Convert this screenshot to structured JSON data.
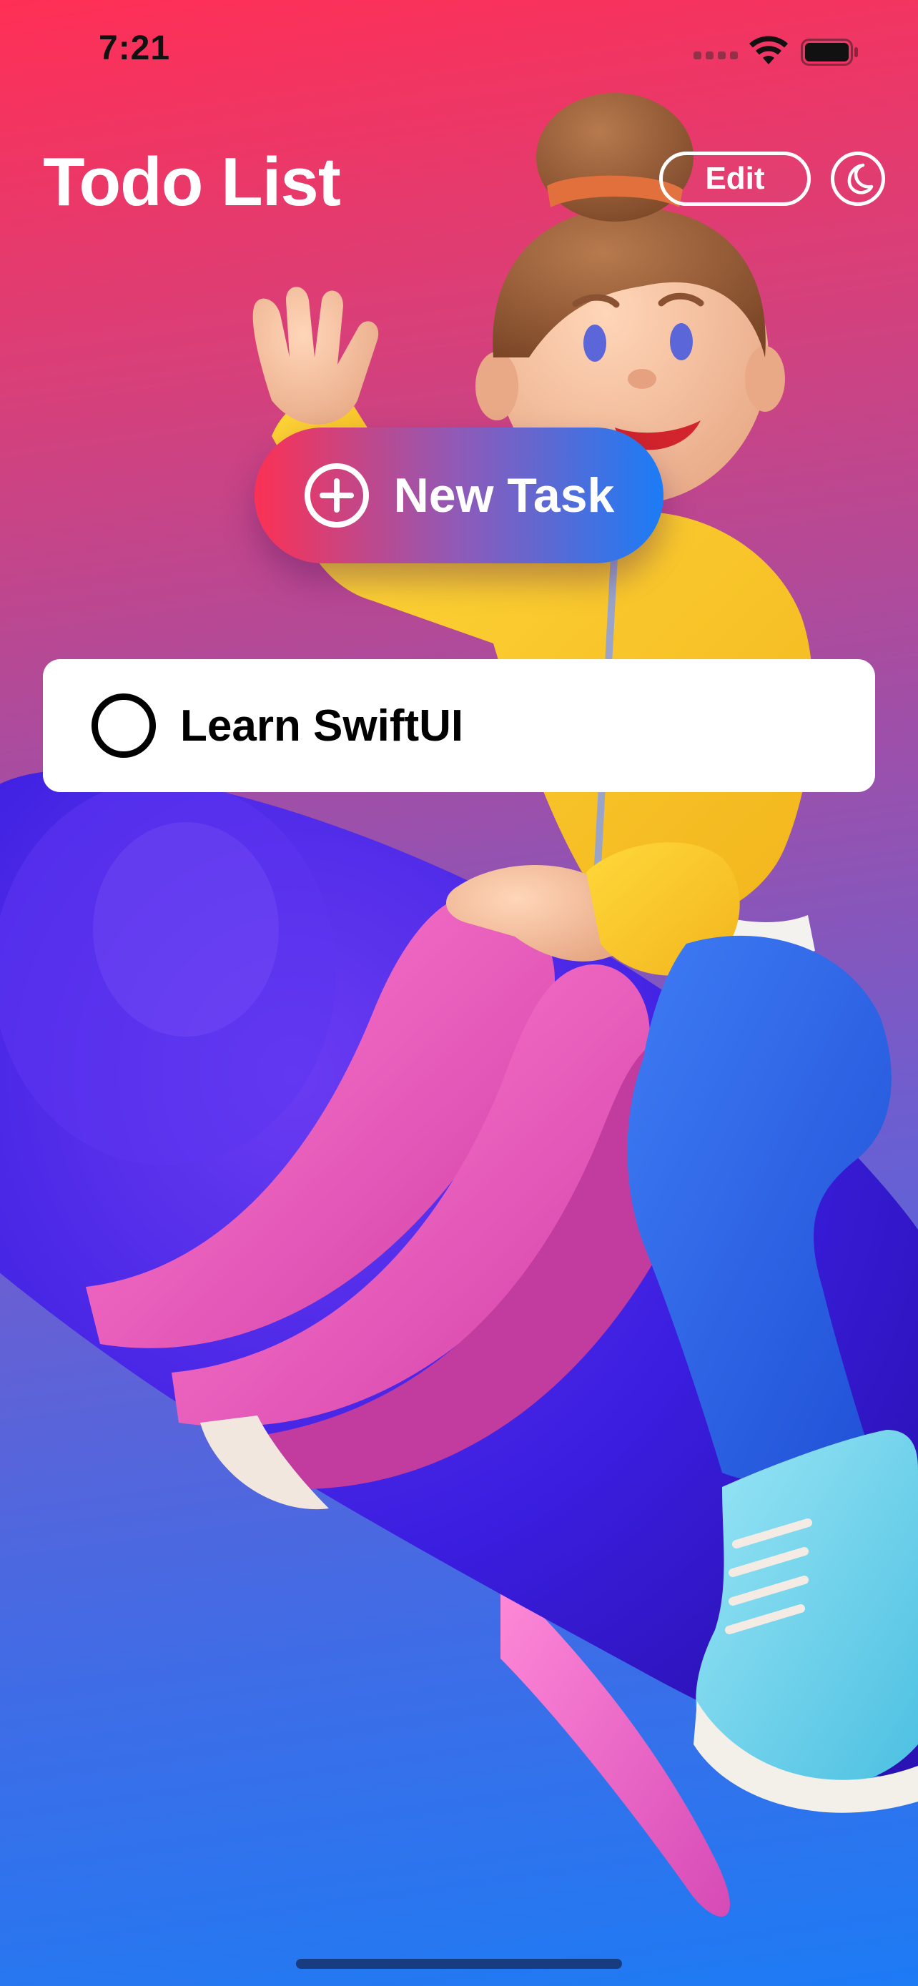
{
  "status_bar": {
    "time": "7:21",
    "icons": [
      "cellular-signal-icon",
      "wifi-icon",
      "battery-icon"
    ]
  },
  "header": {
    "title": "Todo List",
    "edit_label": "Edit",
    "theme_icon": "moon-icon"
  },
  "new_task": {
    "label": "New Task",
    "icon": "plus-circle-icon"
  },
  "tasks": [
    {
      "title": "Learn SwiftUI",
      "completed": false
    }
  ],
  "illustration": {
    "subject": "3d-girl-riding-rocket"
  },
  "colors": {
    "background_top": "#ff2f55",
    "background_bottom": "#1d7bf4",
    "button_gradient_start": "#fb3154",
    "button_gradient_end": "#1b7cf6",
    "card_background": "#ffffff",
    "text_primary": "#000000",
    "text_on_gradient": "#ffffff"
  }
}
